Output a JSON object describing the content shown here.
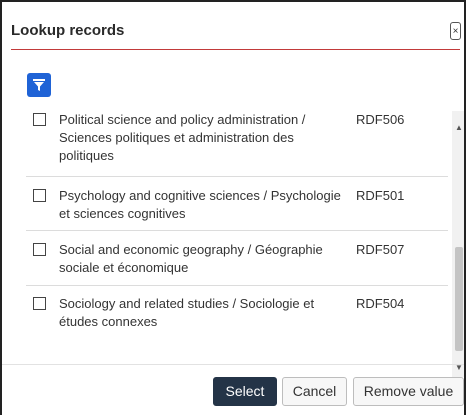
{
  "dialog": {
    "title": "Lookup records",
    "close_symbol": "×"
  },
  "filter": {
    "icon": "filter-icon",
    "color": "#1f63d6"
  },
  "records": [
    {
      "label": "Political science and policy administration / Sciences politiques et administration des politiques",
      "code": "RDF506"
    },
    {
      "label": "Psychology and cognitive sciences / Psychologie et sciences cognitives",
      "code": "RDF501"
    },
    {
      "label": "Social and economic geography / Géographie sociale et économique",
      "code": "RDF507"
    },
    {
      "label": "Sociology and related studies / Sociologie et études connexes",
      "code": "RDF504"
    }
  ],
  "scrollbar": {
    "up_symbol": "▲",
    "down_symbol": "▼"
  },
  "footer": {
    "select_label": "Select",
    "cancel_label": "Cancel",
    "remove_label": "Remove value"
  }
}
